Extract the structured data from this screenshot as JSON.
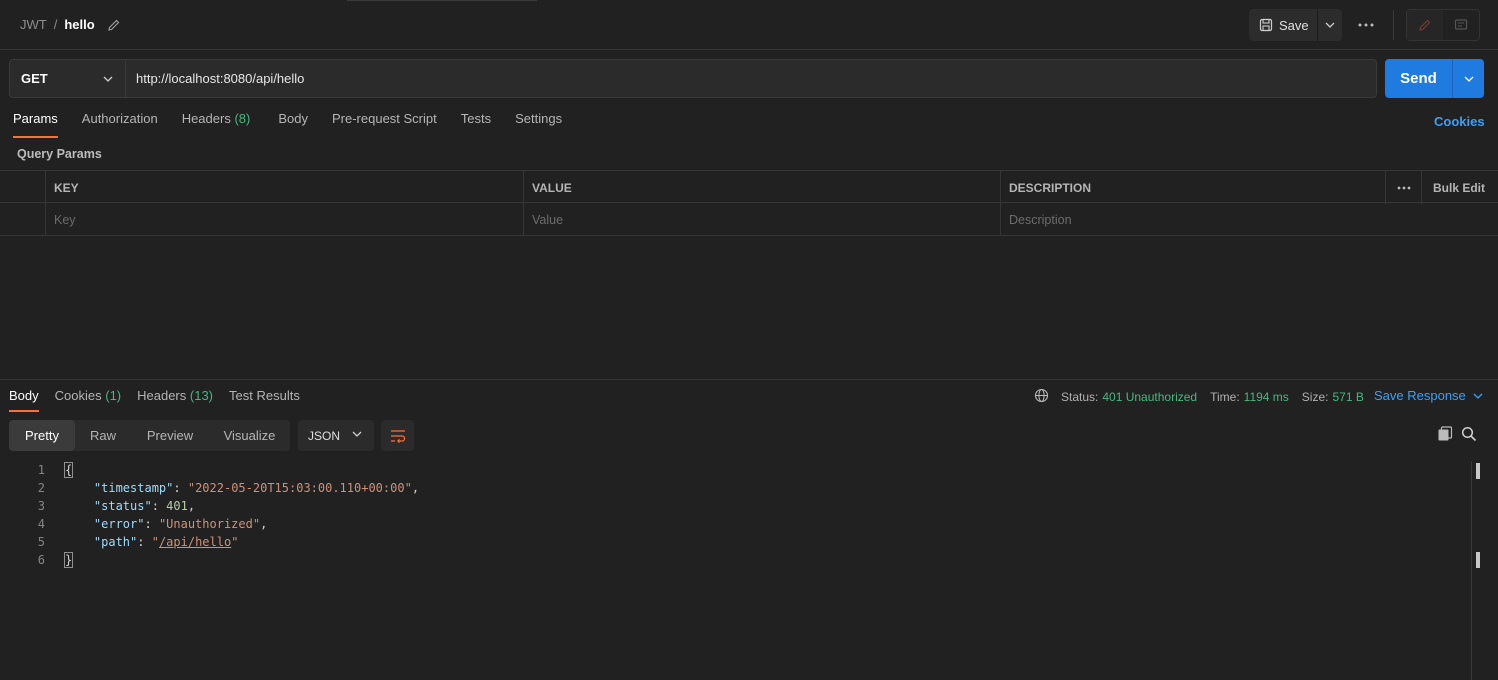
{
  "breadcrumb": {
    "collection": "JWT",
    "separator": "/",
    "request": "hello"
  },
  "toolbar": {
    "save_label": "Save"
  },
  "request": {
    "method": "GET",
    "url": "http://localhost:8080/api/hello",
    "send_label": "Send"
  },
  "request_tabs": {
    "params": "Params",
    "authorization": "Authorization",
    "headers": "Headers",
    "headers_count": "(8)",
    "body": "Body",
    "pre_request": "Pre-request Script",
    "tests": "Tests",
    "settings": "Settings",
    "cookies": "Cookies"
  },
  "query_params": {
    "title": "Query Params",
    "columns": {
      "key": "KEY",
      "value": "VALUE",
      "description": "DESCRIPTION",
      "bulk_edit": "Bulk Edit"
    },
    "placeholders": {
      "key": "Key",
      "value": "Value",
      "description": "Description"
    }
  },
  "response_tabs": {
    "body": "Body",
    "cookies": "Cookies",
    "cookies_count": "(1)",
    "headers": "Headers",
    "headers_count": "(13)",
    "test_results": "Test Results"
  },
  "response_meta": {
    "status_label": "Status:",
    "status_value": "401 Unauthorized",
    "time_label": "Time:",
    "time_value": "1194 ms",
    "size_label": "Size:",
    "size_value": "571 B",
    "save_response": "Save Response"
  },
  "view_modes": {
    "pretty": "Pretty",
    "raw": "Raw",
    "preview": "Preview",
    "visualize": "Visualize",
    "format": "JSON"
  },
  "response_body": {
    "line_numbers": [
      "1",
      "2",
      "3",
      "4",
      "5",
      "6"
    ],
    "open_brace": "{",
    "close_brace": "}",
    "timestamp_key": "\"timestamp\"",
    "timestamp_value": "\"2022-05-20T15:03:00.110+00:00\"",
    "status_key": "\"status\"",
    "status_value": "401",
    "error_key": "\"error\"",
    "error_value": "\"Unauthorized\"",
    "path_key": "\"path\"",
    "path_value": "/api/hello",
    "colon": ": ",
    "comma": ",",
    "quote": "\""
  },
  "colors": {
    "accent": "#ff6c37",
    "primary": "#1f7be0",
    "success": "#47b881",
    "link": "#3e9ff5"
  }
}
